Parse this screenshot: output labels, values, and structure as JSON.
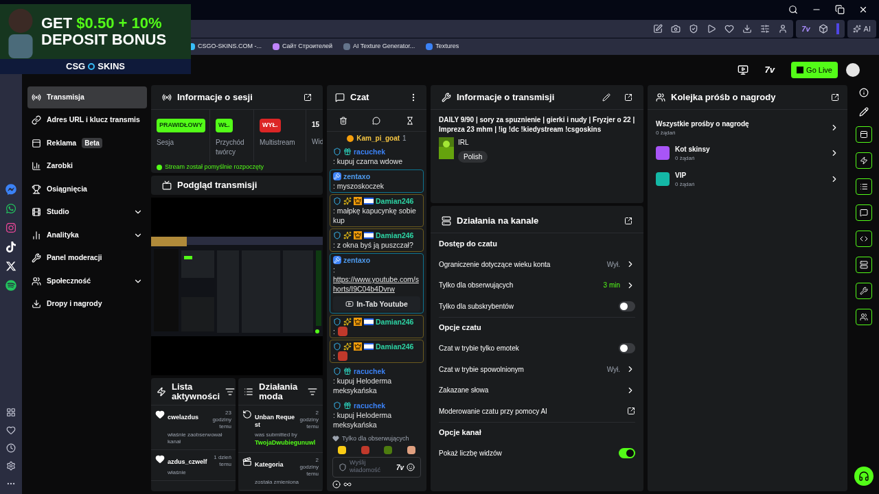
{
  "ad": {
    "line_1": "GET",
    "amount": "$0.50 + 10%",
    "line_2": "DEPOSIT BONUS",
    "brand_1": "CSG",
    "brand_2": "SKINS"
  },
  "toolbar": {
    "seventv": "7v",
    "ai": "AI"
  },
  "bookmarks": [
    "CSGO-SKINS.COM -...",
    "Сайт Строителей",
    "AI Texture Generator...",
    "Textures"
  ],
  "header": {
    "seventv": "7v",
    "go_live": "Go Live"
  },
  "nav": [
    {
      "label": "Transmisja",
      "selected": true,
      "has_submenu": false
    },
    {
      "label": "Adres URL i klucz transmis",
      "selected": false,
      "has_submenu": false
    },
    {
      "label": "Reklama",
      "badge": "Beta",
      "selected": false,
      "has_submenu": false
    },
    {
      "label": "Zarobki",
      "selected": false,
      "has_submenu": false
    },
    {
      "label": "Osiągnięcia",
      "selected": false,
      "has_submenu": false
    },
    {
      "label": "Studio",
      "selected": false,
      "has_submenu": true
    },
    {
      "label": "Analityka",
      "selected": false,
      "has_submenu": true
    },
    {
      "label": "Panel moderacji",
      "selected": false,
      "has_submenu": false
    },
    {
      "label": "Społeczność",
      "selected": false,
      "has_submenu": true
    },
    {
      "label": "Dropy i nagrody",
      "selected": false,
      "has_submenu": false
    }
  ],
  "session": {
    "title": "Informacje o sesji",
    "stats": [
      {
        "badge": "PRAWIDŁOWY",
        "on": true,
        "label": "Sesja"
      },
      {
        "badge": "WŁ.",
        "on": true,
        "label": "Przychód twórcy"
      },
      {
        "badge": "WYŁ.",
        "on": false,
        "label": "Multistream"
      },
      {
        "value": "15",
        "label": "Wid"
      }
    ],
    "notice": "Stream został pomyślnie rozpoczęty"
  },
  "preview": {
    "title": "Podgląd transmisji"
  },
  "activity": {
    "title": "Lista aktywności",
    "items": [
      {
        "user": "cwelazdus",
        "time": "23 godziny temu",
        "text": "właśnie zaobserwował kanał"
      },
      {
        "user": "azdus_czwelf",
        "time": "1 dzień temu",
        "text": "właśnie"
      }
    ]
  },
  "mod_actions": {
    "title": "Działania moda",
    "items": [
      {
        "title": "Unban Request",
        "time": "2 godziny temu",
        "text": "was submitted by",
        "user": "TwojaDwubiegunuwl"
      },
      {
        "title": "Kategoria",
        "time": "2 godziny temu",
        "text": "została zmieniona"
      }
    ]
  },
  "chat": {
    "title": "Czat",
    "pinned": {
      "user": "Kam_pi_goat",
      "count": "1"
    },
    "messages": [
      {
        "user": "racuchek",
        "color": "#3b82f6",
        "moderator": false,
        "vip": false,
        "kind": "text",
        "text": ": kupuj czarna wdowe",
        "highlighted": false
      },
      {
        "user": "zentaxo",
        "color": "#4f9cf0",
        "moderator": true,
        "vip": false,
        "kind": "text",
        "text": ": myszoskoczek",
        "highlighted": true
      },
      {
        "user": "Damian246",
        "color": "#2dd4a4",
        "moderator": false,
        "vip": true,
        "kind": "text",
        "text": ": małpkę kapucynkę sobie kup",
        "highlighted": true
      },
      {
        "user": "Damian246",
        "color": "#2dd4a4",
        "moderator": false,
        "vip": true,
        "kind": "text",
        "text": ": z okna byś ją puszczał?",
        "highlighted": true
      },
      {
        "user": "zentaxo",
        "color": "#4f9cf0",
        "moderator": true,
        "vip": false,
        "kind": "link",
        "text": ":",
        "link": "https://www.youtube.com/shorts/I9C04b4Dvrw",
        "button": "In-Tab Youtube",
        "highlighted": true
      },
      {
        "user": "Damian246",
        "color": "#2dd4a4",
        "moderator": false,
        "vip": true,
        "kind": "emote",
        "text": ":",
        "highlighted": true
      },
      {
        "user": "Damian246",
        "color": "#2dd4a4",
        "moderator": false,
        "vip": true,
        "kind": "emote",
        "text": ":",
        "highlighted": true
      },
      {
        "user": "racuchek",
        "color": "#3b82f6",
        "moderator": false,
        "vip": false,
        "kind": "text",
        "text": ": kupuj Heloderma meksykańska",
        "highlighted": false
      },
      {
        "user": "racuchek",
        "color": "#3b82f6",
        "moderator": false,
        "vip": false,
        "kind": "text",
        "text": ": kupuj Heloderma meksykańska",
        "highlighted": false
      }
    ],
    "mode_note": "Tylko dla obserwujących",
    "input_placeholder": "Wyślij wiadomość",
    "seventv": "7v"
  },
  "stream_info": {
    "title": "Informacje o transmisji",
    "stream_title": "DAILY 9/90 | sory za spuznienie | gierki i nudy | Fryzjer o 22 | Impreza 23 mhm | !ig !dc !kiedystream !csgoskins",
    "category": "IRL",
    "tag": "Polish"
  },
  "channel_actions": {
    "title": "Działania na kanale",
    "sections": [
      {
        "heading": "Dostęp do czatu",
        "rows": [
          {
            "label": "Ograniczenie dotyczące wieku konta",
            "kind": "nav",
            "value": "Wył.",
            "on": false
          },
          {
            "label": "Tylko dla obserwujących",
            "kind": "nav",
            "value": "3 min",
            "on": true
          },
          {
            "label": "Tylko dla subskrybentów",
            "kind": "toggle",
            "on": false
          }
        ]
      },
      {
        "heading": "Opcje czatu",
        "rows": [
          {
            "label": "Czat w trybie tylko emotek",
            "kind": "toggle",
            "on": false
          },
          {
            "label": "Czat w trybie spowolnionym",
            "kind": "nav",
            "value": "Wył.",
            "on": false
          },
          {
            "label": "Zakazane słowa",
            "kind": "nav"
          },
          {
            "label": "Moderowanie czatu przy pomocy AI",
            "kind": "external"
          }
        ]
      },
      {
        "heading": "Opcje kanał",
        "rows": [
          {
            "label": "Pokaż liczbę widzów",
            "kind": "toggle",
            "on": true
          }
        ]
      }
    ]
  },
  "queue": {
    "title": "Kolejka próśb o nagrody",
    "all": {
      "label": "Wszystkie prośby o nagrodę",
      "count": "0 żądań"
    },
    "items": [
      {
        "label": "Kot skinsy",
        "count": "0 żądań",
        "color": "#a855f7"
      },
      {
        "label": "VIP",
        "count": "0 żądań",
        "color": "#14b8a6"
      }
    ]
  }
}
